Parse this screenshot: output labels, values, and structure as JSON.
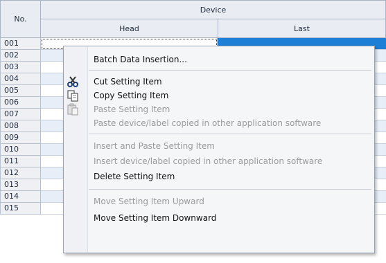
{
  "table": {
    "col_no": "No.",
    "group_header": "Device",
    "col_head": "Head",
    "col_last": "Last",
    "rows": [
      "001",
      "002",
      "003",
      "004",
      "005",
      "006",
      "007",
      "008",
      "009",
      "010",
      "011",
      "012",
      "013",
      "014",
      "015"
    ]
  },
  "context_menu": {
    "batch_insert": "Batch Data Insertion...",
    "cut": "Cut Setting Item",
    "copy": "Copy Setting Item",
    "paste": "Paste Setting Item",
    "paste_external": "Paste device/label copied in other application software",
    "insert_paste": "Insert and Paste Setting Item",
    "insert_external": "Insert device/label copied in other application software",
    "delete": "Delete Setting Item",
    "move_up": "Move Setting Item Upward",
    "move_down": "Move Setting Item Downward"
  },
  "icons": {
    "cut": "scissors-icon",
    "copy": "copy-icon",
    "paste": "paste-icon"
  },
  "colors": {
    "selection": "#1e7fd6",
    "header_bg": "#e9ecf2",
    "alt_row": "#e8eef8",
    "disabled_text": "#9b9b9b"
  }
}
